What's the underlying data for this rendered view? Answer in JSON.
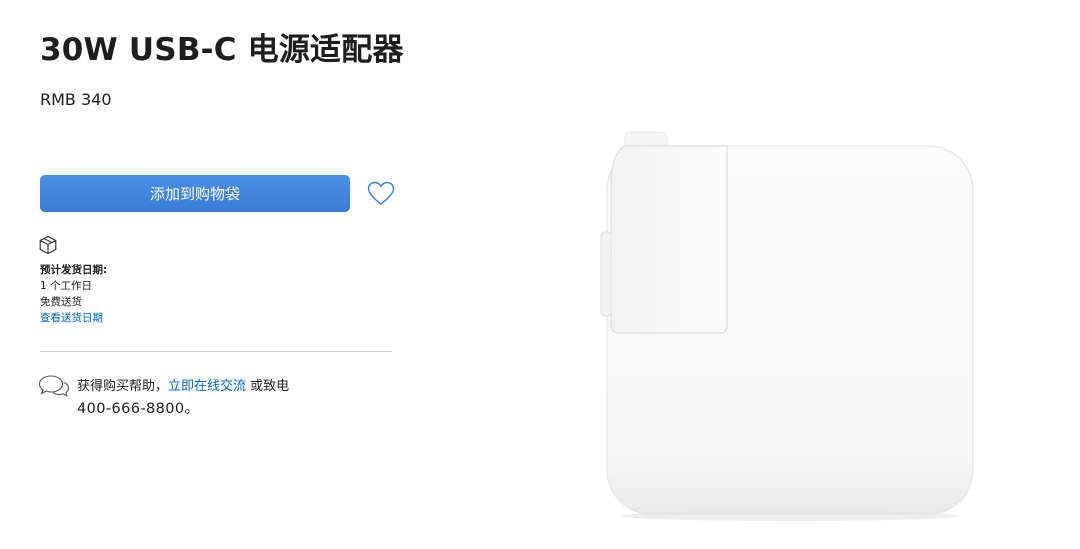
{
  "product": {
    "title": "30W USB-C 电源适配器",
    "price": "RMB 340"
  },
  "actions": {
    "add_to_bag_label": "添加到购物袋"
  },
  "icons": {
    "favorite": "heart-icon",
    "shipping": "box-icon",
    "chat": "chat-bubbles-icon"
  },
  "delivery": {
    "heading": "预计发货日期:",
    "lead_time": "1 个工作日",
    "shipping_fee": "免费送货",
    "check_dates_link": "查看送货日期"
  },
  "help": {
    "prefix": "获得购买帮助，",
    "chat_link": "立即在线交流",
    "middle": " 或致电",
    "phone": "400-666-8800。"
  },
  "colors": {
    "button": "#3a7bd5",
    "link": "#0066cc",
    "text": "#1d1d1f"
  }
}
